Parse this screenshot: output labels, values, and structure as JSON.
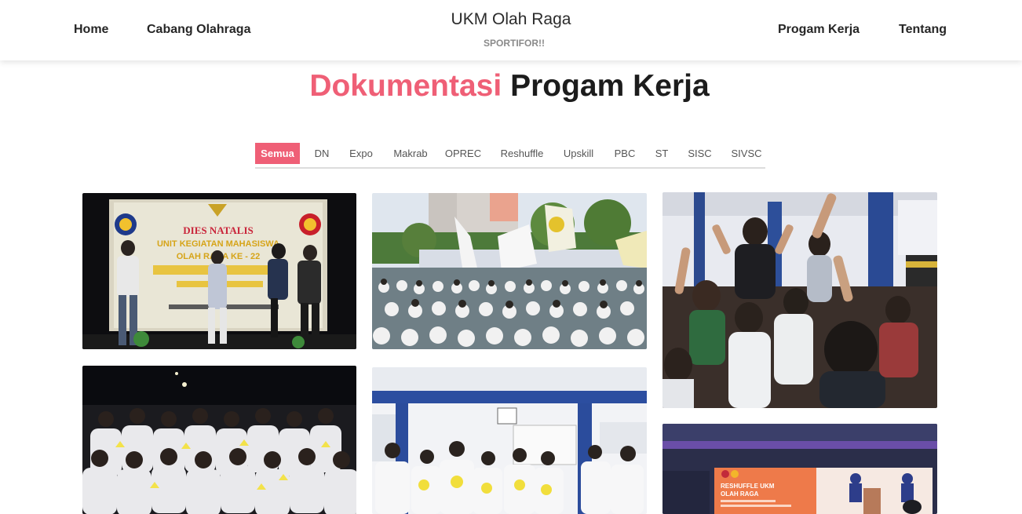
{
  "nav": {
    "home": "Home",
    "cabang": "Cabang Olahraga",
    "progam": "Progam Kerja",
    "tentang": "Tentang"
  },
  "brand": {
    "title": "UKM Olah Raga",
    "subtitle": "SPORTIFOR!!"
  },
  "section": {
    "title_accent": "Dokumentasi",
    "title_rest": "Progam Kerja"
  },
  "filters": {
    "active": "Semua",
    "items": [
      "Semua",
      "DN",
      "Expo",
      "Makrab",
      "OPREC",
      "Reshuffle",
      "Upskill",
      "PBC",
      "ST",
      "SISC",
      "SIVSC"
    ]
  },
  "photos": {
    "dies_banner_line1": "DIES NATALIS",
    "dies_banner_line2": "UNIT KEGIATAN MAHASISWA",
    "dies_banner_line3": "OLAH RAGA KE - 22",
    "reshuffle_screen_line1": "RESHUFFLE UKM",
    "reshuffle_screen_line2": "OLAH RAGA"
  },
  "colors": {
    "accent": "#ef5f76",
    "text_dark": "#262626",
    "muted": "#8a8a8a"
  }
}
